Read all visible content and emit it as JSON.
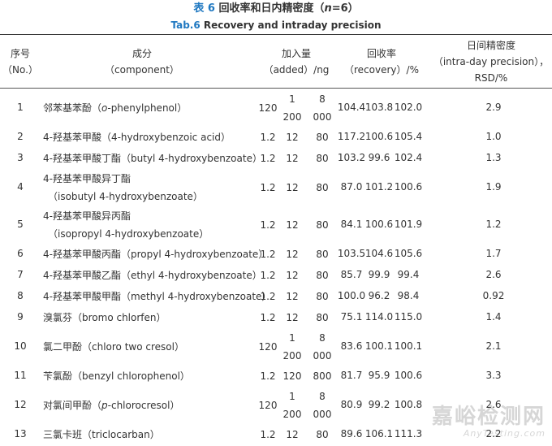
{
  "caption": {
    "cn_prefix": "表 6",
    "cn_title_pre": "回收率和日内精密度（",
    "cn_n": "n",
    "cn_title_post": "=6）",
    "en_prefix": "Tab.6",
    "en_title": "Recovery and intraday precision"
  },
  "headers": {
    "no_cn": "序号",
    "no_en": "（No.）",
    "component_cn": "成分",
    "component_en": "（component）",
    "added_cn": "加入量",
    "added_en": "（added）/ng",
    "recovery_cn": "回收率",
    "recovery_en": "（recovery）/%",
    "precision_cn": "日间精密度",
    "precision_en1": "（intra-day precision），",
    "precision_en2": "RSD/%"
  },
  "rows": [
    {
      "no": "1",
      "comp_lines": [
        "邻苯基苯酚（o-phenylphenol）"
      ],
      "added": [
        "120",
        "1\n200",
        "8\n000"
      ],
      "recovery": [
        "104.4",
        "103.8",
        "102.0"
      ],
      "rsd": "2.9"
    },
    {
      "no": "2",
      "comp_lines": [
        "4-羟基苯甲酸（4-hydroxybenzoic acid）"
      ],
      "added": [
        "1.2",
        "12",
        "80"
      ],
      "recovery": [
        "117.2",
        "100.6",
        "105.4"
      ],
      "rsd": "1.0"
    },
    {
      "no": "3",
      "comp_lines": [
        "4-羟基苯甲酸丁酯（butyl 4-hydroxybenzoate）"
      ],
      "added": [
        "1.2",
        "12",
        "80"
      ],
      "recovery": [
        "103.2",
        "99.6",
        "102.4"
      ],
      "rsd": "1.3"
    },
    {
      "no": "4",
      "comp_lines": [
        "4-羟基苯甲酸异丁酯",
        "（isobutyl 4-hydroxybenzoate）"
      ],
      "added": [
        "1.2",
        "12",
        "80"
      ],
      "recovery": [
        "87.0",
        "101.2",
        "100.6"
      ],
      "rsd": "1.9"
    },
    {
      "no": "5",
      "comp_lines": [
        "4-羟基苯甲酸异丙酯",
        "（isopropyl 4-hydroxybenzoate）"
      ],
      "added": [
        "1.2",
        "12",
        "80"
      ],
      "recovery": [
        "84.1",
        "100.6",
        "101.9"
      ],
      "rsd": "1.2"
    },
    {
      "no": "6",
      "comp_lines": [
        "4-羟基苯甲酸丙酯（propyl 4-hydroxybenzoate）"
      ],
      "added": [
        "1.2",
        "12",
        "80"
      ],
      "recovery": [
        "103.5",
        "104.6",
        "105.6"
      ],
      "rsd": "1.7"
    },
    {
      "no": "7",
      "comp_lines": [
        "4-羟基苯甲酸乙酯（ethyl 4-hydroxybenzoate）"
      ],
      "added": [
        "1.2",
        "12",
        "80"
      ],
      "recovery": [
        "85.7",
        "99.9",
        "99.4"
      ],
      "rsd": "2.6"
    },
    {
      "no": "8",
      "comp_lines": [
        "4-羟基苯甲酸甲酯（methyl 4-hydroxybenzoate）"
      ],
      "added": [
        "1.2",
        "12",
        "80"
      ],
      "recovery": [
        "100.0",
        "96.2",
        "98.4"
      ],
      "rsd": "0.92"
    },
    {
      "no": "9",
      "comp_lines": [
        "溴氯芬（bromo chlorfen）"
      ],
      "added": [
        "1.2",
        "12",
        "80"
      ],
      "recovery": [
        "75.1",
        "114.0",
        "115.0"
      ],
      "rsd": "1.4"
    },
    {
      "no": "10",
      "comp_lines": [
        "氯二甲酚（chloro two cresol）"
      ],
      "added": [
        "120",
        "1\n200",
        "8\n000"
      ],
      "recovery": [
        "83.6",
        "100.1",
        "100.1"
      ],
      "rsd": "2.1"
    },
    {
      "no": "11",
      "comp_lines": [
        "苄氯酚（benzyl chlorophenol）"
      ],
      "added": [
        "1.2",
        "120",
        "800"
      ],
      "recovery": [
        "81.7",
        "95.9",
        "100.6"
      ],
      "rsd": "3.3"
    },
    {
      "no": "12",
      "comp_lines": [
        "对氯间甲酚（p-chlorocresol）"
      ],
      "added": [
        "120",
        "1\n200",
        "8\n000"
      ],
      "recovery": [
        "80.9",
        "99.2",
        "100.8"
      ],
      "rsd": "2.6"
    },
    {
      "no": "13",
      "comp_lines": [
        "三氯卡班（triclocarban）"
      ],
      "added": [
        "1.2",
        "12",
        "80"
      ],
      "recovery": [
        "89.6",
        "106.1",
        "111.3"
      ],
      "rsd": "2.2"
    }
  ],
  "watermark": {
    "cn": "嘉峪检测网",
    "en": "AnyTesting.com"
  }
}
